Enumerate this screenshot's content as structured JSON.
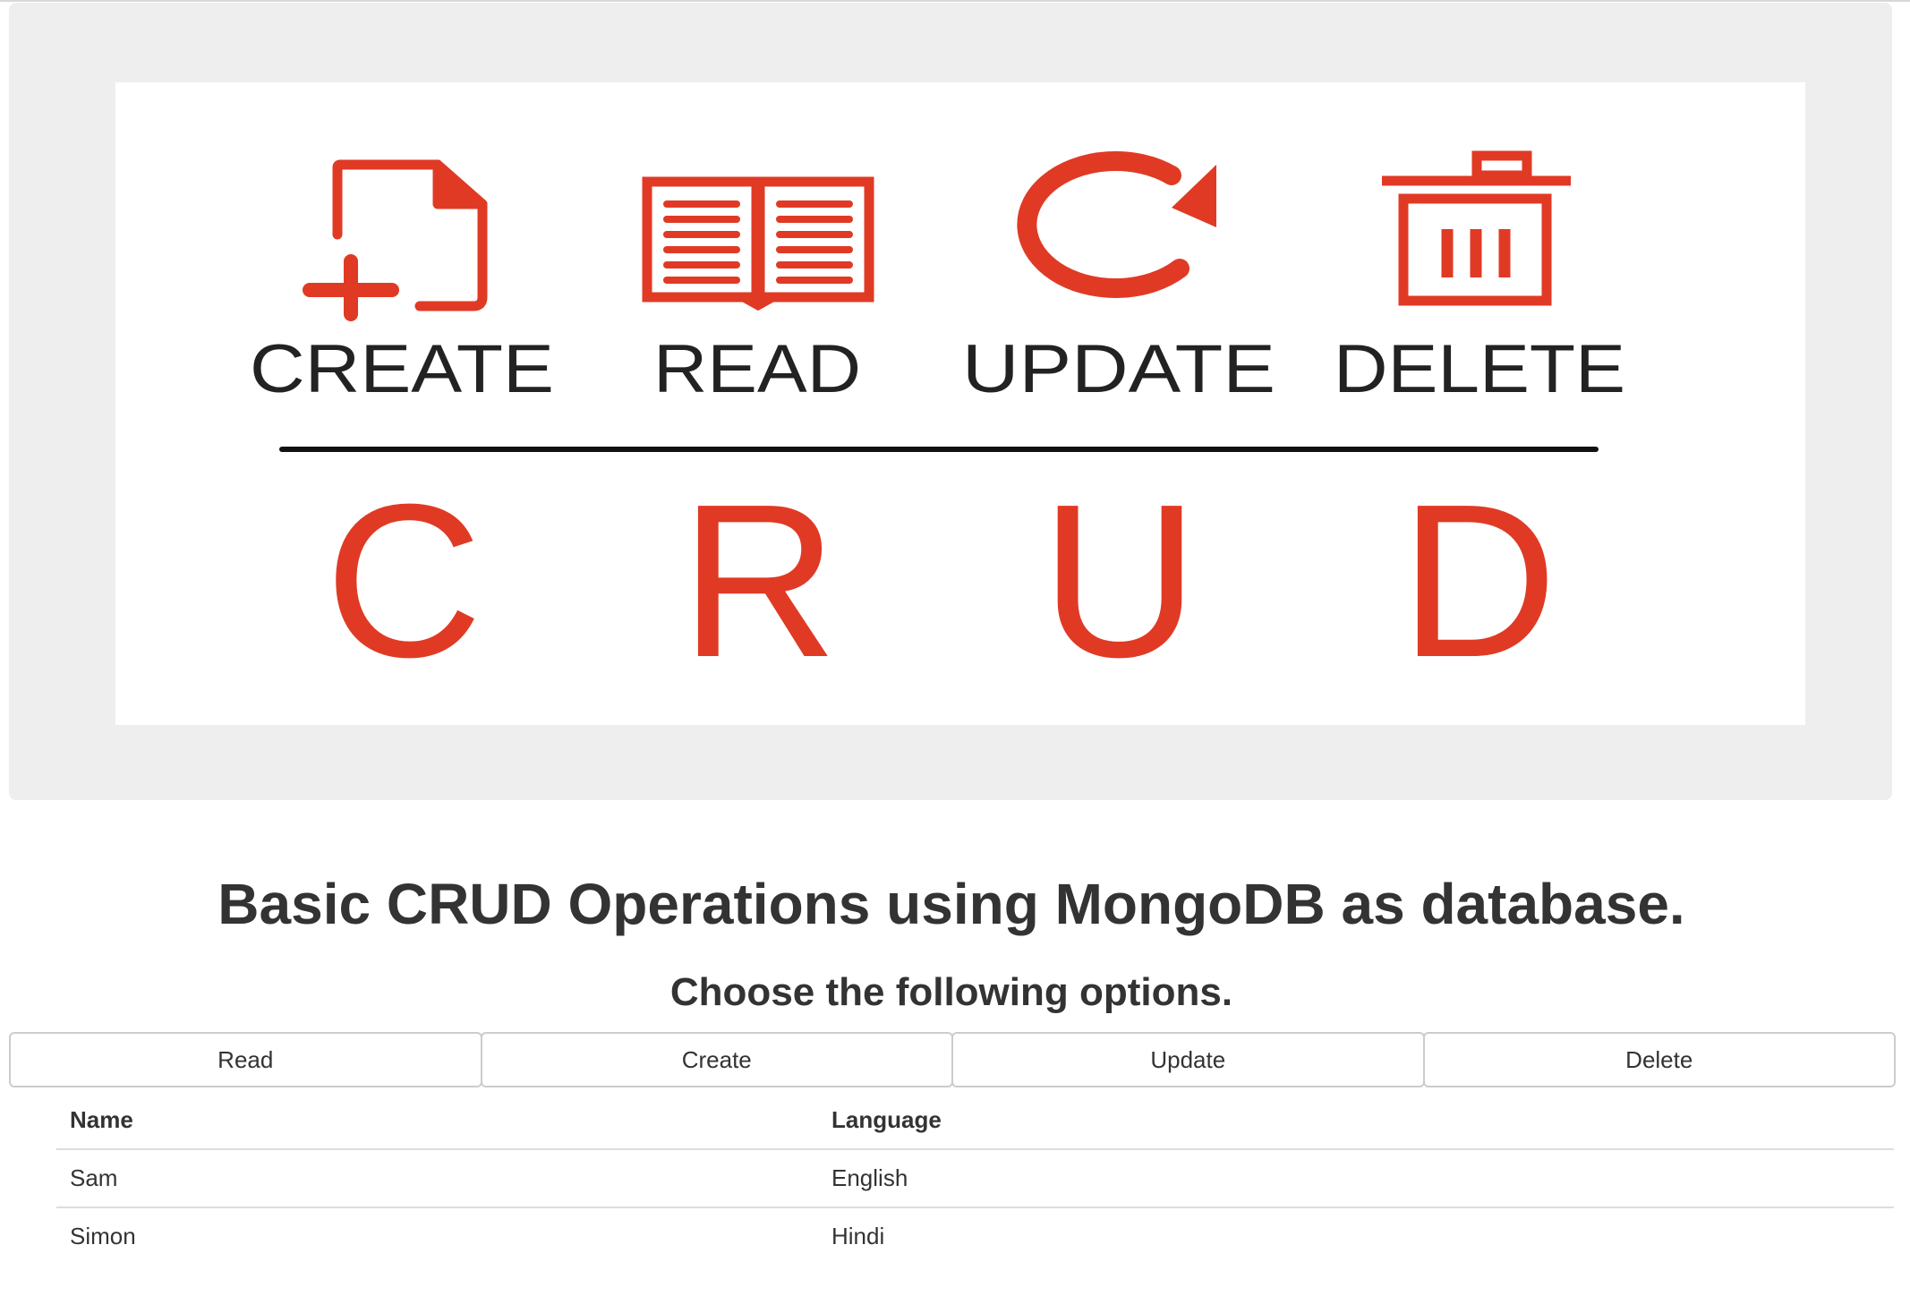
{
  "banner": {
    "operations": [
      "CREATE",
      "READ",
      "UPDATE",
      "DELETE"
    ],
    "letters": [
      "C",
      "R",
      "U",
      "D"
    ],
    "icons": [
      "file-add-icon",
      "book-icon",
      "refresh-icon",
      "trash-icon"
    ],
    "accent_color": "#e03a25"
  },
  "main": {
    "title": "Basic CRUD Operations using MongoDB as database.",
    "subtitle": "Choose the following options."
  },
  "buttons": {
    "read": "Read",
    "create": "Create",
    "update": "Update",
    "delete": "Delete"
  },
  "table": {
    "headers": {
      "name": "Name",
      "language": "Language"
    },
    "rows": [
      {
        "name": "Sam",
        "language": "English"
      },
      {
        "name": "Simon",
        "language": "Hindi"
      }
    ]
  }
}
